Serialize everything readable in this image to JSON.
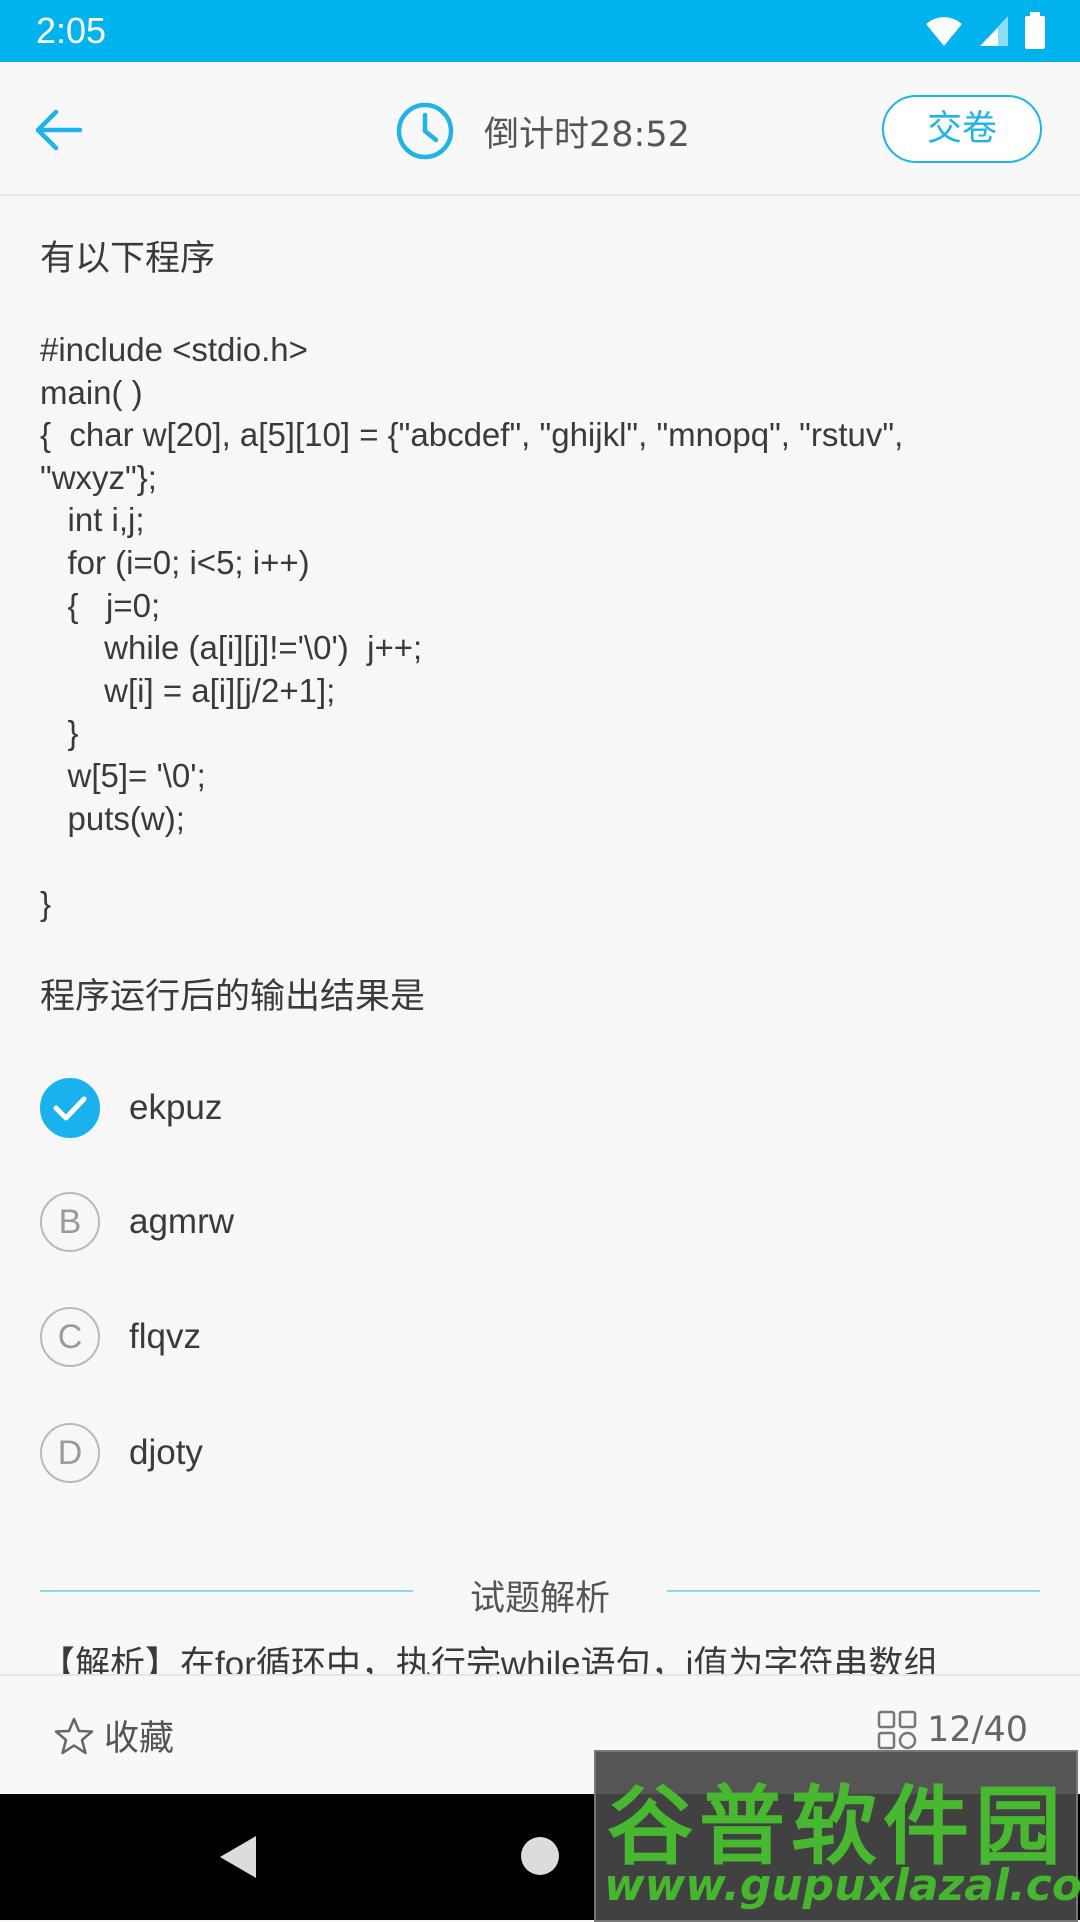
{
  "status_bar": {
    "time": "2:05",
    "background_color": "#00b3ec",
    "icons": [
      "wifi-icon",
      "signal-icon",
      "battery-icon"
    ]
  },
  "header": {
    "timer_text": "倒计时28:52",
    "submit_label": "交卷",
    "accent_color": "#1fb3e8"
  },
  "question": {
    "title": "有以下程序",
    "code": "#include <stdio.h>\nmain( )\n{  char w[20], a[5][10] = {\"abcdef\", \"ghijkl\", \"mnopq\", \"rstuv\",\n\"wxyz\"};\n   int i,j;\n   for (i=0; i<5; i++)\n   {   j=0;\n       while (a[i][j]!='\\0')  j++;\n       w[i] = a[i][j/2+1];\n   }\n   w[5]= '\\0';\n   puts(w);\n\n}",
    "stem": "程序运行后的输出结果是",
    "options": [
      {
        "letter": "A",
        "text": "ekpuz",
        "selected": true
      },
      {
        "letter": "B",
        "text": "agmrw",
        "selected": false
      },
      {
        "letter": "C",
        "text": "flqvz",
        "selected": false
      },
      {
        "letter": "D",
        "text": "djoty",
        "selected": false
      }
    ]
  },
  "analysis": {
    "title": "试题解析",
    "text": "【解析】在for循环中，执行完while语句，j值为字符串数组"
  },
  "bottom_bar": {
    "favorite_label": "收藏",
    "progress_label": "12/40"
  },
  "watermark": {
    "logo": "谷普软件园",
    "url": "www.gupuxlazal.com"
  }
}
